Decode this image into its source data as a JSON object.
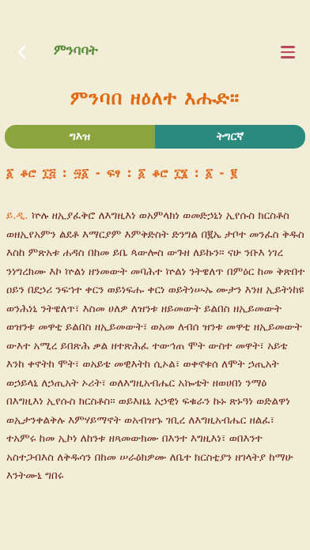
{
  "header": {
    "title": "ምንባባት",
    "back_icon": "chevron-left-icon",
    "menu_icon": "hamburger-menu-icon",
    "accent_color": "#5a8a3a",
    "menu_color": "#b5495b"
  },
  "page": {
    "title": "ምንባበ ዘዕለተ እሑድ።"
  },
  "tabs": [
    {
      "label": "ግእዝ",
      "active": true,
      "color": "#8aa53f"
    },
    {
      "label": "ትግርኛ",
      "active": false,
      "color": "#2a8a7d"
    }
  ],
  "reading": {
    "heading": "፩ ቆሮ ፲፭ : ፵፩ - ፍፃ : ፩ ቆሮ ፲፮ : ፩ - ፪",
    "lead": "ይ.ዲ.",
    "text": "ኵሉ ዘኢያፈቅሮ ለእግዚእነ ወአምላክነ ወመድኃኒነ ኢየሱስ ክርስቶስ ወዘኢየአምን ልደቶ እማርያም እምቅድስት ድንግል በ፪ኤ ታቦተ መንፈስ ቅዱስ እስከ ምጽአቱ ሐዳስ በከመ ይቤ ጳውሎስ ውጉዘ ለይኩን። ናሁ ንቡእ ነገረ ንነግረክሙ እኮ ኵልነ ዘንመውት መባሕተ ኵልነ ንትዌለጥ በምዕር ከመ ቅጽበተ ዐይን በደኃሪ ንፍኀተ ቀርን ወይነፍሑ ቀርነ ወይትነሡኡ ሙታን እንዘ ኢይትነከዩ ወንሕነኒ ንትዌለጥ፣ እስመ ሀለዎ ለዝንቱ ዘይመውት ይልበስ ዘኢይመውት ወዝንቱ መዋቲ ይልበስ ዘኢይመውት፣ ወአመ ለብሰ ዝንቱ መዋቲ ዘኢይመውት ውእተ አሚረ ይበጽሕ ቃል ዘተጽሕፈ ተውኅጠ ሞት ውስተ መዋት፣ አይቴ እንከ ቀኖትከ ሞት፣ ወአይቴ መዊእትከ ሲኦል፣ ወቀኖቱሰ ለሞት ኃጢአት ወኃይላኒ ለኃጢአት ኦሪት፣ ወለእግዚአብሔር አኰቴት ዘወሀበነ ንማዕ በእግዚእነ ኢየሱስ ክርስቶስ። ወይእዜኒ አኃዊነ ፍቁራን ኩኑ ጽኑዓነ ወድልዋነ ወኢታንቀልቅሉ እምሃይማኖት ወአብዝኁ ገቢረ ለእግዚአብሔር ዘልፈ፣ ተአምሩ ከመ ኢኮነ ለከንቱ ዘጻመውክሙ በእንተ እግዚእነ፣ ወበእንተ አስተጋብእስ ለቅዱሳን በከመ ሠራዕክዎሙ ለቤተ ክርስቲያን ዘገላትያ ከማሁ እንትሙኒ ግበሩ"
  }
}
